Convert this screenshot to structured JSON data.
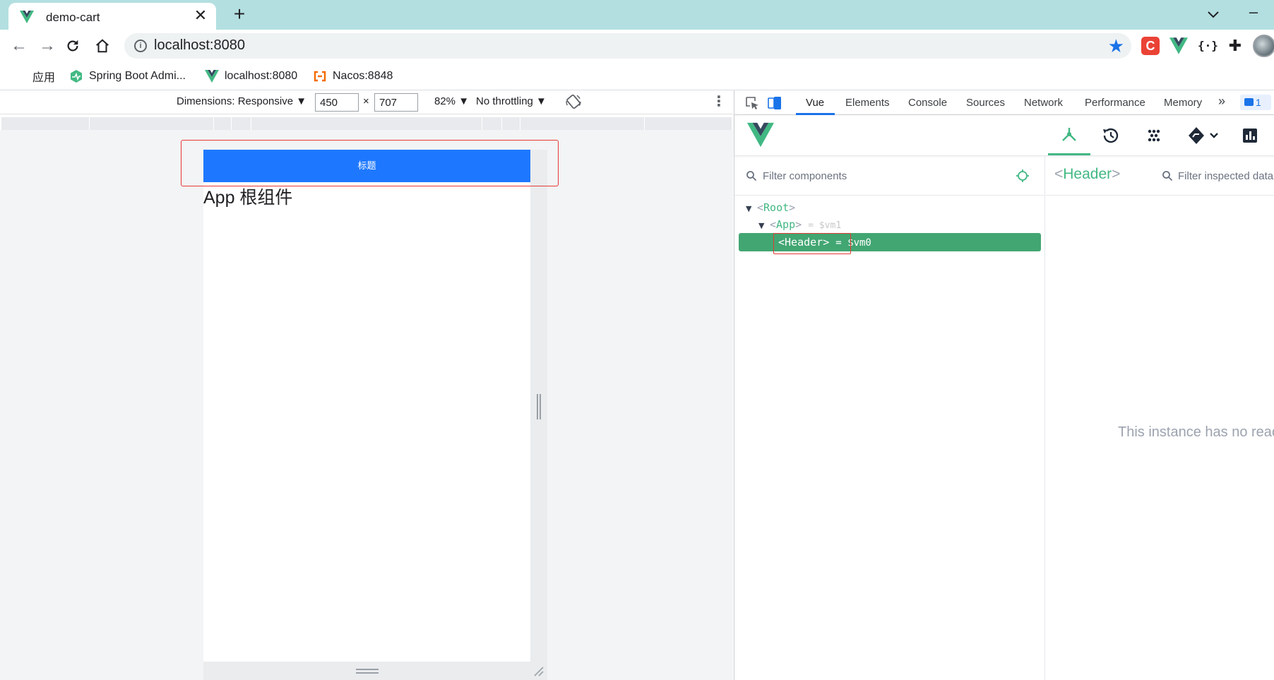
{
  "browser": {
    "tab": {
      "title": "demo-cart",
      "close_label": "✕"
    },
    "new_tab_label": "+",
    "url": "localhost:8080",
    "bookmarks": [
      {
        "label": "应用"
      },
      {
        "label": "Spring Boot Admi..."
      },
      {
        "label": "localhost:8080"
      },
      {
        "label": "Nacos:8848"
      }
    ]
  },
  "device_toolbar": {
    "dimensions_label": "Dimensions: Responsive ▼",
    "width": "450",
    "height": "707",
    "times": "×",
    "zoom_label": "82% ▼",
    "throttle_label": "No throttling ▼"
  },
  "page": {
    "header_title": "标题",
    "app_text": "App 根组件"
  },
  "devtools": {
    "tabs": [
      "Vue",
      "Elements",
      "Console",
      "Sources",
      "Network",
      "Performance",
      "Memory"
    ],
    "active_tab": "Vue",
    "more_label": "»",
    "issues_count": "1",
    "vue": {
      "filter_components_placeholder": "Filter components",
      "tree": [
        {
          "name": "Root",
          "ref": ""
        },
        {
          "name": "App",
          "ref": "= $vm1"
        },
        {
          "name": "Header",
          "ref": "= $vm0"
        }
      ],
      "inspected_component": "Header",
      "filter_inspected_placeholder": "Filter inspected data",
      "empty_message": "This instance has no reactive state"
    }
  },
  "colors": {
    "tabstrip": "#b3dfe0",
    "header_bar": "#1e78ff",
    "vue_green": "#42b883",
    "selected_row": "#42a672",
    "highlight_red": "#e53935"
  }
}
